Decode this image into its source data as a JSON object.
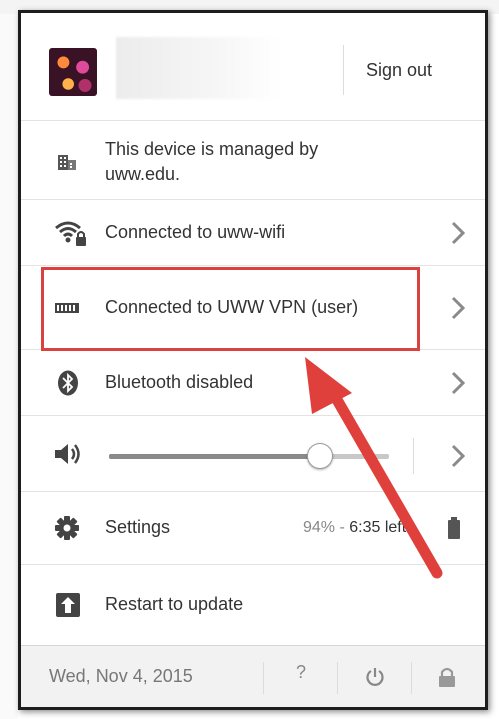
{
  "user": {
    "signout_label": "Sign out"
  },
  "managed": {
    "text_line1": "This device is managed by",
    "text_line2": "uww.edu."
  },
  "network": {
    "wifi_label": "Connected to uww-wifi",
    "vpn_label": "Connected to UWW VPN (user)"
  },
  "bluetooth": {
    "label": "Bluetooth disabled"
  },
  "volume": {
    "level": 0.75
  },
  "settings": {
    "label": "Settings",
    "battery_percent": "94%",
    "separator": " - ",
    "time_left": "6:35 left"
  },
  "update": {
    "label": "Restart to update"
  },
  "footer": {
    "date": "Wed, Nov 4, 2015",
    "help_label": "?"
  },
  "colors": {
    "accent_annotation": "#d9423f",
    "panel_border": "#1d1d1d"
  },
  "icons": [
    "avatar",
    "managed-building-icon",
    "wifi-lock-icon",
    "vpn-icon",
    "bluetooth-icon",
    "speaker-icon",
    "gear-icon",
    "battery-icon",
    "restart-update-icon",
    "help-icon",
    "power-icon",
    "lock-icon",
    "chevron-right-icon"
  ]
}
